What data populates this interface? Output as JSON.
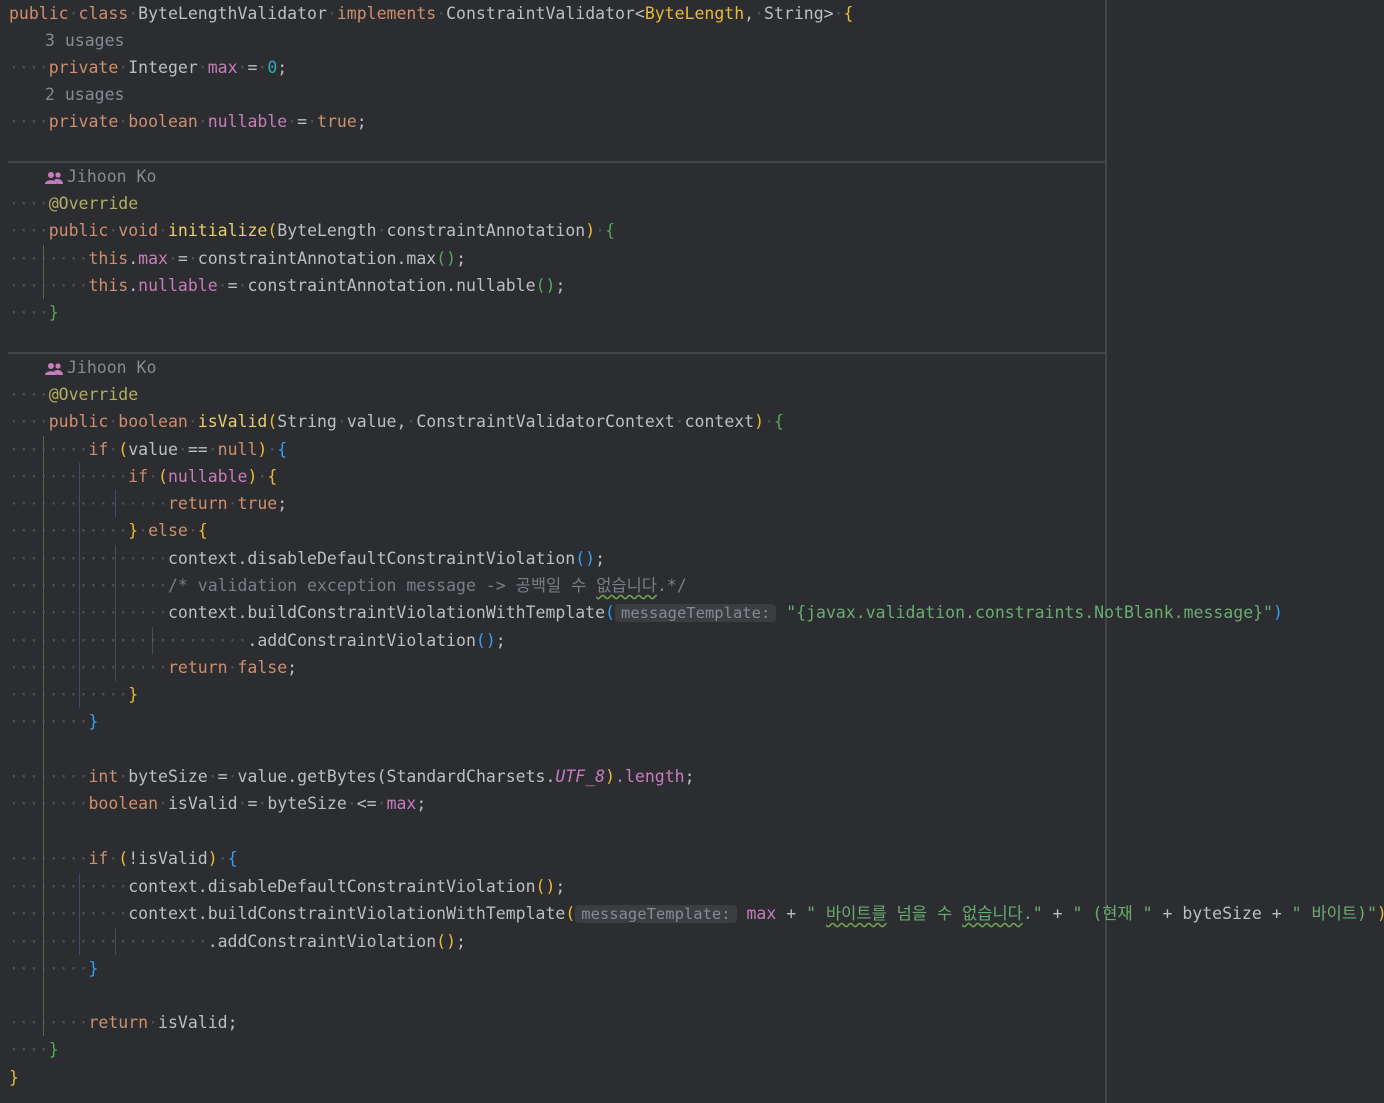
{
  "code": {
    "class_keyword_public": "public",
    "class_keyword_class": "class",
    "class_name": "ByteLengthValidator",
    "implements_kw": "implements",
    "interface_name": "ConstraintValidator",
    "generic_1": "ByteLength",
    "generic_2": "String",
    "usages_1": "3 usages",
    "field1_kw": "private",
    "field1_type": "Integer",
    "field1_name": "max",
    "field1_value": "0",
    "usages_2": "2 usages",
    "field2_kw": "private",
    "field2_type": "boolean",
    "field2_name": "nullable",
    "field2_value": "true",
    "author_1": "Jihoon Ko",
    "override_1": "@Override",
    "m1_mods": "public",
    "m1_ret": "void",
    "m1_name": "initialize",
    "m1_param_type": "ByteLength",
    "m1_param_name": "constraintAnnotation",
    "m1_line1_obj": "constraintAnnotation.max",
    "m1_line2_obj": "constraintAnnotation.nullable",
    "author_2": "Jihoon Ko",
    "override_2": "@Override",
    "m2_mods": "public",
    "m2_ret": "boolean",
    "m2_name": "isValid",
    "m2_p1_type": "String",
    "m2_p1_name": "value",
    "m2_p2_type": "ConstraintValidatorContext",
    "m2_p2_name": "context",
    "disable_call": "context.disableDefaultConstraintViolation",
    "comment_prefix": "/* validation exception message -> 공백일 수 ",
    "comment_squiggle": "없습니다",
    "comment_suffix": ".*/",
    "build_call": "context.buildConstraintViolationWithTemplate",
    "hint_label": "messageTemplate:",
    "template_string_1": "\"{javax.validation.constraints.NotBlank.message}\"",
    "add_violation": ".addConstraintViolation",
    "bytesize_expr_start": "value.getBytes(StandardCharsets.",
    "charset_const": "UTF_8",
    "length_field": ".length",
    "bytesize_var": "byteSize",
    "isvalid_var": "isValid",
    "str_part_1_open": "\" ",
    "str_part_1_squig_a": "바이트를",
    "str_part_1_mid": " 넘을 수 ",
    "str_part_1_squig_b": "없습니다",
    "str_part_1_close": ".\"",
    "str_part_2": "\" (현재 \"",
    "str_part_3": "\" 바이트)\"",
    "return_kw": "return"
  }
}
